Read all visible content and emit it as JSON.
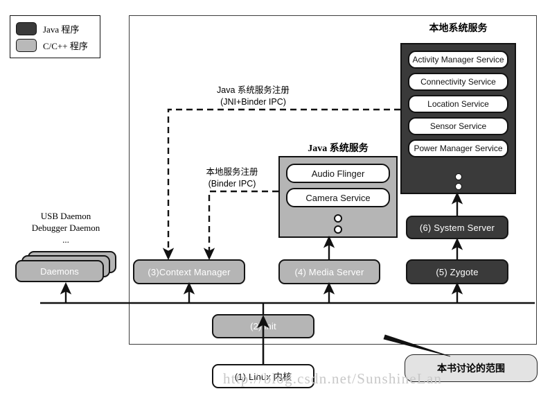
{
  "legend": {
    "items": [
      {
        "label": "Java 程序",
        "color": "#3a3a3a",
        "kind": "java"
      },
      {
        "label": "C/C++ 程序",
        "color": "#b9b9b9",
        "kind": "cpp"
      }
    ]
  },
  "groups": {
    "native_services": {
      "title": "本地系统服务",
      "color": "#3a3a3a",
      "services": [
        "Activity Manager Service",
        "Connectivity Service",
        "Location Service",
        "Sensor Service",
        "Power Manager Service"
      ],
      "more_indicator": "⋮"
    },
    "java_services": {
      "title": "Java 系统服务",
      "color": "#b5b5b5",
      "services": [
        "Audio Flinger",
        "Camera Service"
      ],
      "more_indicator": "⋮"
    }
  },
  "daemons": {
    "stack_label": "Daemons",
    "caption_lines": [
      "USB Daemon",
      "Debugger Daemon",
      "..."
    ]
  },
  "processes": [
    {
      "id": "context-manager",
      "label": "(3)Context Manager",
      "kind": "cpp"
    },
    {
      "id": "media-server",
      "label": "(4) Media Server",
      "kind": "cpp"
    },
    {
      "id": "zygote",
      "label": "(5) Zygote",
      "kind": "java"
    },
    {
      "id": "system-server",
      "label": "(6) System Server",
      "kind": "java"
    },
    {
      "id": "init",
      "label": "(2) init",
      "kind": "cpp"
    },
    {
      "id": "linux-kernel",
      "label": "(1) Linux 内核",
      "kind": "kernel"
    }
  ],
  "annotations": {
    "java_registration": {
      "line1": "Java 系统服务注册",
      "line2": "(JNI+Binder IPC)"
    },
    "native_registration": {
      "line1": "本地服务注册",
      "line2": "(Binder IPC)"
    },
    "scope_callout": "本书讨论的范围"
  },
  "watermark": "http://blog.csdn.net/SunshineLan"
}
